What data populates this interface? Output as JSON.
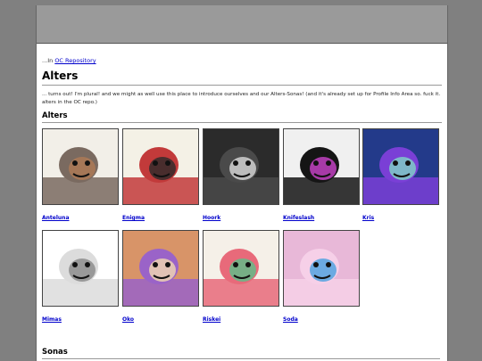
{
  "breadcrumb": {
    "prefix": "...In ",
    "link": "OC Repository"
  },
  "page_title": "Alters",
  "intro_text": "... turns out! I'm plural! and we might as well use this place to introduce ourselves and our Alters-Sonas! (and it's already set up for Profile Info Area so. fuck it. alters in the OC repo.)",
  "sections": {
    "alters": "Alters",
    "sonas": "Sonas"
  },
  "alters": [
    {
      "name": "Anteluna",
      "colors": [
        "#7a6a60",
        "#f2efe8",
        "#b07a55"
      ]
    },
    {
      "name": "Enigma",
      "colors": [
        "#c23a3a",
        "#f4f1e6",
        "#2a2a2a"
      ]
    },
    {
      "name": "Hoork",
      "colors": [
        "#4a4a4a",
        "#2b2b2b",
        "#d8d8d8"
      ]
    },
    {
      "name": "Knifeslash",
      "colors": [
        "#151515",
        "#f0f0f0",
        "#cc44cc"
      ]
    },
    {
      "name": "Kris",
      "colors": [
        "#7a3fd6",
        "#233a8a",
        "#7fd6c6"
      ]
    },
    {
      "name": "Mimas",
      "colors": [
        "#dcdcdc",
        "#ffffff",
        "#888888"
      ]
    },
    {
      "name": "Oko",
      "colors": [
        "#9a63c8",
        "#d89468",
        "#f3d9b0"
      ]
    },
    {
      "name": "Riskei",
      "colors": [
        "#e86a7a",
        "#f5f0e8",
        "#5ac08a"
      ]
    },
    {
      "name": "Soda",
      "colors": [
        "#f6d0e8",
        "#e8b8d8",
        "#4aa0e0"
      ]
    }
  ]
}
